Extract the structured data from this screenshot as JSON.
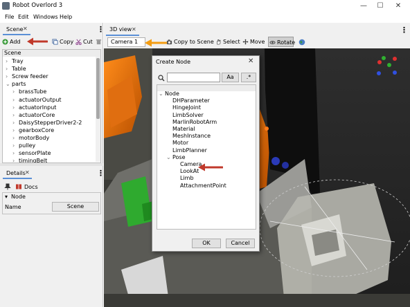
{
  "window": {
    "title": "Robot Overlord 3",
    "controls": [
      "—",
      "☐",
      "✕"
    ]
  },
  "menu": [
    "File",
    "Edit",
    "Windows",
    "Help"
  ],
  "scene_panel": {
    "tab_label": "Scene",
    "tab_close": "✕",
    "toolbar": {
      "add": "Add",
      "copy": "Copy",
      "cut": "Cut"
    },
    "root": "Scene",
    "items": [
      {
        "label": "Tray",
        "level": 0,
        "expanded": false
      },
      {
        "label": "Table",
        "level": 0,
        "expanded": false
      },
      {
        "label": "Screw feeder",
        "level": 0,
        "expanded": false
      },
      {
        "label": "parts",
        "level": 0,
        "expanded": true
      },
      {
        "label": "brassTube",
        "level": 1,
        "expanded": false
      },
      {
        "label": "actuatorOutput",
        "level": 1,
        "expanded": false
      },
      {
        "label": "actuatorInput",
        "level": 1,
        "expanded": false
      },
      {
        "label": "actuatorCore",
        "level": 1,
        "expanded": false
      },
      {
        "label": "DaisyStepperDriver2-2",
        "level": 1,
        "expanded": false
      },
      {
        "label": "gearboxCore",
        "level": 1,
        "expanded": false
      },
      {
        "label": "motorBody",
        "level": 1,
        "expanded": false
      },
      {
        "label": "pulley",
        "level": 1,
        "expanded": false
      },
      {
        "label": "sensorPlate",
        "level": 1,
        "expanded": false
      },
      {
        "label": "timingBelt",
        "level": 1,
        "expanded": false
      }
    ]
  },
  "details_panel": {
    "tab_label": "Details",
    "tab_close": "✕",
    "docs_label": "Docs",
    "section_label": "Node",
    "name_label": "Name",
    "name_value": "Scene"
  },
  "view_panel": {
    "tab_label": "3D view",
    "tab_close": "✕",
    "camera_select": "Camera 1",
    "toolbar": {
      "copy_to_scene": "Copy to Scene",
      "select": "Select",
      "move": "Move",
      "rotate": "Rotate"
    }
  },
  "dialog": {
    "title": "Create Node",
    "close": "✕",
    "search_placeholder": "",
    "case_toggle": "Aa",
    "regex_toggle": ".*",
    "tree": [
      {
        "label": "Node",
        "level": 0,
        "expanded": true
      },
      {
        "label": "DHParameter",
        "level": 1
      },
      {
        "label": "HingeJoint",
        "level": 1
      },
      {
        "label": "LimbSolver",
        "level": 1
      },
      {
        "label": "MarlinRobotArm",
        "level": 1
      },
      {
        "label": "Material",
        "level": 1
      },
      {
        "label": "MeshInstance",
        "level": 1
      },
      {
        "label": "Motor",
        "level": 1
      },
      {
        "label": "LimbPlanner",
        "level": 1
      },
      {
        "label": "Pose",
        "level": 1,
        "expanded": true
      },
      {
        "label": "Camera",
        "level": 2
      },
      {
        "label": "LookAt",
        "level": 2
      },
      {
        "label": "Limb",
        "level": 2
      },
      {
        "label": "AttachmentPoint",
        "level": 2
      }
    ],
    "ok": "OK",
    "cancel": "Cancel"
  },
  "colors": {
    "annotation_arrow_red": "#c0392b",
    "annotation_arrow_orange": "#f39c12",
    "selection_blue": "#cce4f7"
  }
}
